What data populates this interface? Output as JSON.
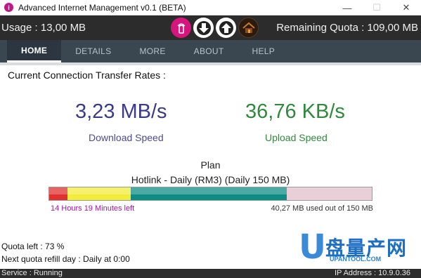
{
  "window": {
    "title": "Advanced Internet Management v0.1 (BETA)",
    "minimize": "—",
    "maximize": "☐",
    "close": "✕"
  },
  "status": {
    "usage": "Usage : 13,00 MB",
    "remaining": "Remaining Quota : 109,00 MB",
    "icons": [
      "phone-icon",
      "download-icon",
      "upload-icon",
      "home-icon"
    ]
  },
  "nav": {
    "tabs": [
      "HOME",
      "DETAILS",
      "MORE",
      "ABOUT",
      "HELP"
    ],
    "active": "HOME"
  },
  "main": {
    "section_title": "Current Connection Transfer Rates :",
    "download_value": "3,23 MB/s",
    "download_label": "Download Speed",
    "upload_value": "36,76 KB/s",
    "upload_label": "Upload Speed",
    "plan_title": "Plan",
    "plan_name": "Hotlink - Daily (RM3) (Daily 150 MB)",
    "progress_used_fraction": 0.27,
    "time_left": "14 Hours 19 Minutes left",
    "used_of": "40,27 MB used out of 150 MB",
    "quota_left": "Quota left : 73 %",
    "refill": "Next quota refill day : Daily at 0:00"
  },
  "footer": {
    "service": "Service : Running",
    "ip": "IP Address : 10.9.0.36"
  },
  "watermark": {
    "letter": "U",
    "chinese": "盘量产网",
    "sub": "UPANTOOL.COM"
  },
  "colors": {
    "accent_magenta": "#d6157f",
    "download": "#3a3a8a",
    "upload": "#2e8a3a",
    "progress_teal": "#0e8c84"
  }
}
